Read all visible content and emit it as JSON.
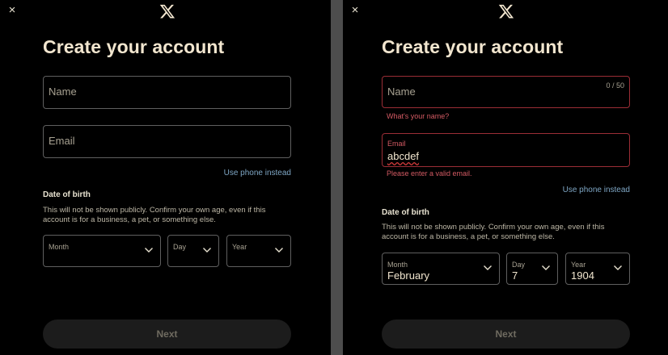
{
  "left": {
    "close_glyph": "×",
    "logo_icon": "x-logo-icon",
    "title": "Create your account",
    "name": {
      "placeholder": "Name"
    },
    "email": {
      "placeholder": "Email"
    },
    "use_phone": "Use phone instead",
    "dob": {
      "heading": "Date of birth",
      "description": "This will not be shown publicly. Confirm your own age, even if this account is for a business, a pet, or something else.",
      "month_label": "Month",
      "day_label": "Day",
      "year_label": "Year"
    },
    "next_label": "Next"
  },
  "right": {
    "close_glyph": "×",
    "logo_icon": "x-logo-icon",
    "title": "Create your account",
    "name": {
      "placeholder": "Name",
      "counter": "0 / 50",
      "error": "What's your name?"
    },
    "email": {
      "label": "Email",
      "value": "abcdef",
      "error": "Please enter a valid email."
    },
    "use_phone": "Use phone instead",
    "dob": {
      "heading": "Date of birth",
      "description": "This will not be shown publicly. Confirm your own age, even if this account is for a business, a pet, or something else.",
      "month_label": "Month",
      "month_value": "February",
      "day_label": "Day",
      "day_value": "7",
      "year_label": "Year",
      "year_value": "1904"
    },
    "next_label": "Next"
  },
  "colors": {
    "background": "#000000",
    "title": "#f2e6cf",
    "error": "#d35a63",
    "error_border": "#9b2d36",
    "link": "#7ea6c4",
    "divider": "#4d4d4d"
  }
}
